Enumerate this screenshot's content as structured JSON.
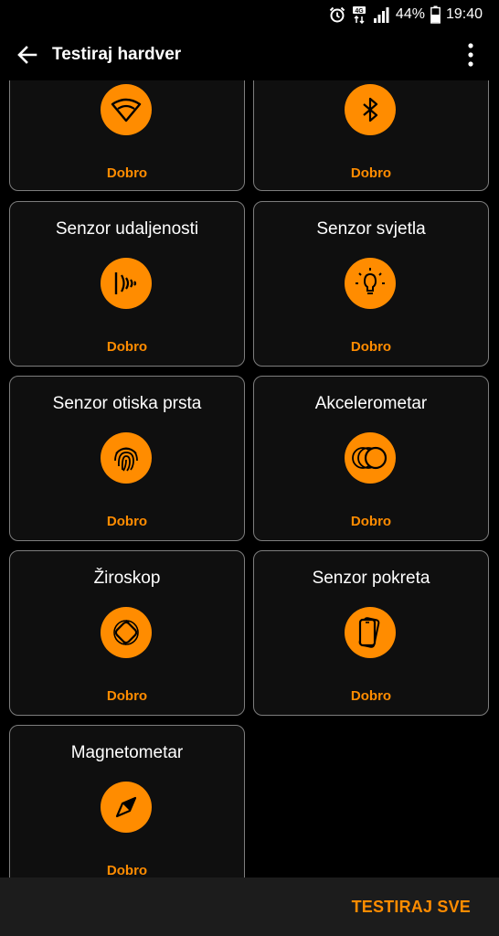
{
  "status_bar": {
    "battery": "44%",
    "time": "19:40",
    "network": "4G",
    "icons": [
      "alarm-icon",
      "network-4g-icon",
      "signal-icon",
      "battery-icon"
    ]
  },
  "app_bar": {
    "title": "Testiraj hardver",
    "back_icon": "arrow-left-icon",
    "more_icon": "more-vertical-icon"
  },
  "cards": [
    {
      "title": "",
      "status": "Dobro",
      "icon": "wifi-icon"
    },
    {
      "title": "",
      "status": "Dobro",
      "icon": "bluetooth-icon"
    },
    {
      "title": "Senzor udaljenosti",
      "status": "Dobro",
      "icon": "proximity-icon"
    },
    {
      "title": "Senzor svjetla",
      "status": "Dobro",
      "icon": "light-bulb-icon"
    },
    {
      "title": "Senzor otiska prsta",
      "status": "Dobro",
      "icon": "fingerprint-icon"
    },
    {
      "title": "Akcelerometar",
      "status": "Dobro",
      "icon": "accelerometer-icon"
    },
    {
      "title": "Žiroskop",
      "status": "Dobro",
      "icon": "gyroscope-icon"
    },
    {
      "title": "Senzor pokreta",
      "status": "Dobro",
      "icon": "motion-sensor-icon"
    },
    {
      "title": "Magnetometar",
      "status": "Dobro",
      "icon": "compass-icon"
    }
  ],
  "bottom_bar": {
    "test_all_label": "TESTIRAJ SVE"
  },
  "colors": {
    "accent": "#ff8c00",
    "background": "#000000",
    "card_border": "#7d7d7d",
    "bottom_bar": "#1c1c1c"
  }
}
